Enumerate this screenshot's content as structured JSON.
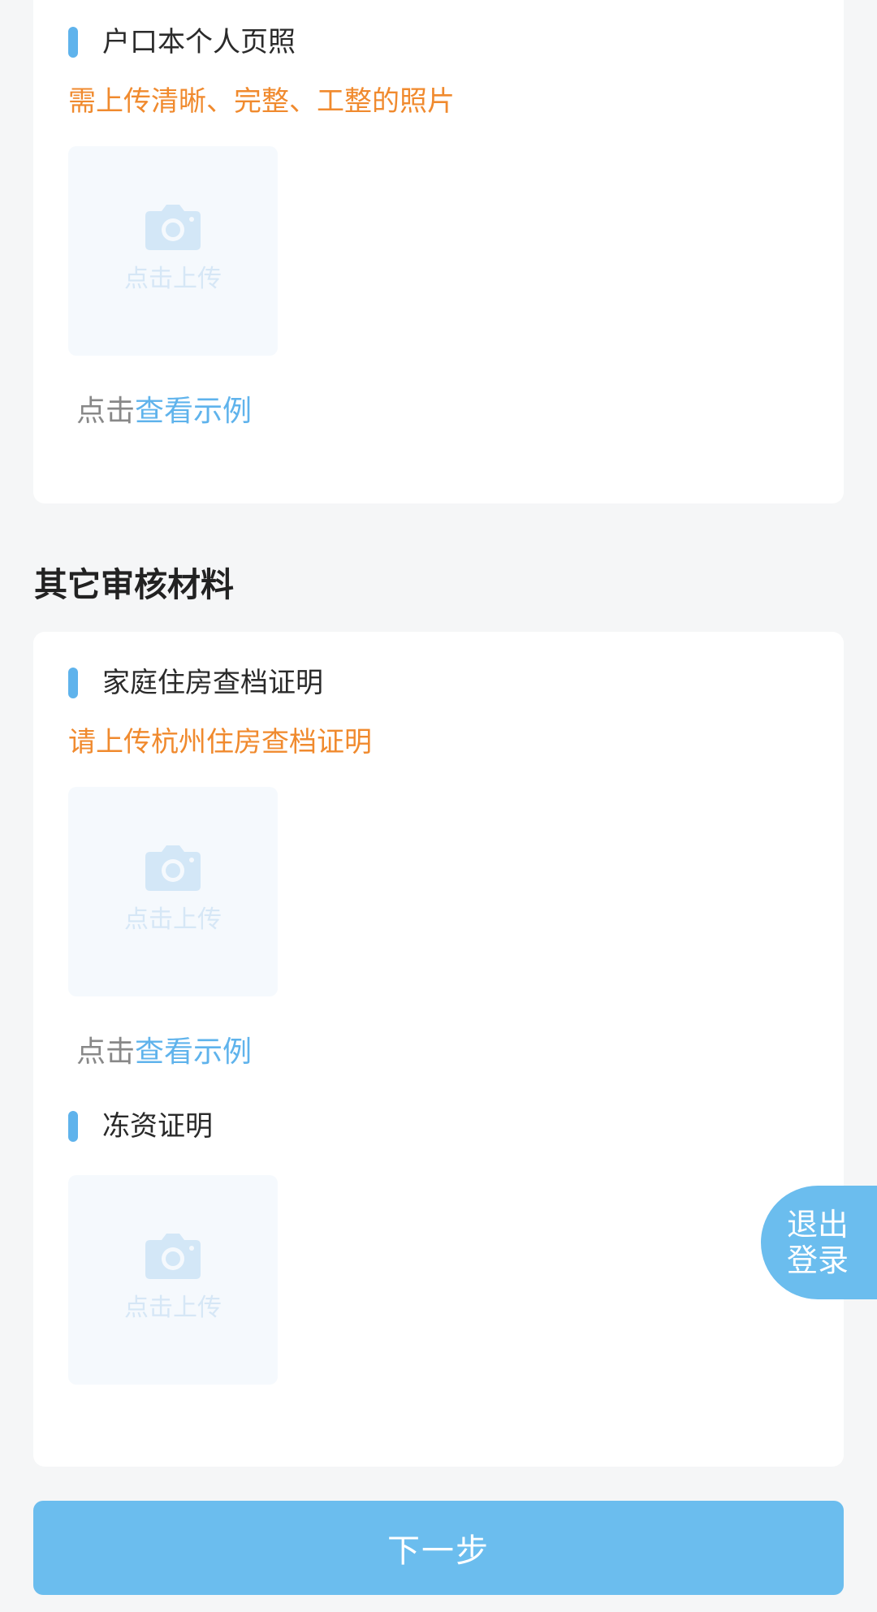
{
  "upload_placeholder": "点击上传",
  "camera_icon": "camera-icon",
  "example_prefix": "点击",
  "example_link": "查看示例",
  "hukou_field": {
    "title": "户口本个人页照",
    "hint": "需上传清晰、完整、工整的照片"
  },
  "other_section": {
    "heading": "其它审核材料"
  },
  "housing_field": {
    "title": "家庭住房查档证明",
    "hint": "请上传杭州住房查档证明"
  },
  "frozen_funds_field": {
    "title": "冻资证明"
  },
  "logout": {
    "line1": "退出",
    "line2": "登录"
  },
  "next_button": "下一步",
  "colors": {
    "accent": "#6bbdee",
    "hint_orange": "#f08a2e",
    "link_blue": "#5fb3ec",
    "background": "#f5f6f7"
  }
}
